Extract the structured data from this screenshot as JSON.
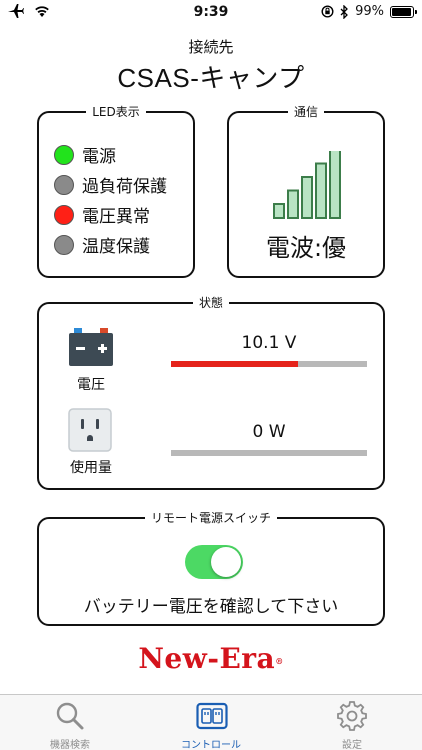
{
  "status_bar": {
    "time": "9:39",
    "battery_percent": "99%"
  },
  "header": {
    "connect_label": "接続先",
    "device_name": "CSAS-キャンプ"
  },
  "led_panel": {
    "title": "LED表示",
    "items": [
      {
        "label": "電源",
        "color": "#22e31c"
      },
      {
        "label": "過負荷保護",
        "color": "#8a8a8a"
      },
      {
        "label": "電圧異常",
        "color": "#ff2016"
      },
      {
        "label": "温度保護",
        "color": "#8a8a8a"
      }
    ]
  },
  "comm_panel": {
    "title": "通信",
    "signal_text": "電波:優",
    "signal_level": 5,
    "signal_max": 5,
    "bar_color": "#b9e4c4",
    "bar_border": "#3c7d4a"
  },
  "status_panel": {
    "title": "状態",
    "voltage": {
      "label": "電圧",
      "value": "10.1 V",
      "level": 0.65,
      "color": "#e5231b"
    },
    "usage": {
      "label": "使用量",
      "value": "0 W",
      "level": 0.0
    }
  },
  "switch_panel": {
    "title": "リモート電源スイッチ",
    "on": true,
    "message": "バッテリー電圧を確認して下さい"
  },
  "brand": {
    "logo": "New-Era",
    "mark": "®"
  },
  "tabbar": {
    "tabs": [
      {
        "label": "機器検索",
        "icon": "search-icon"
      },
      {
        "label": "コントロール",
        "icon": "outlet-icon",
        "active": true
      },
      {
        "label": "設定",
        "icon": "gear-icon"
      }
    ]
  }
}
